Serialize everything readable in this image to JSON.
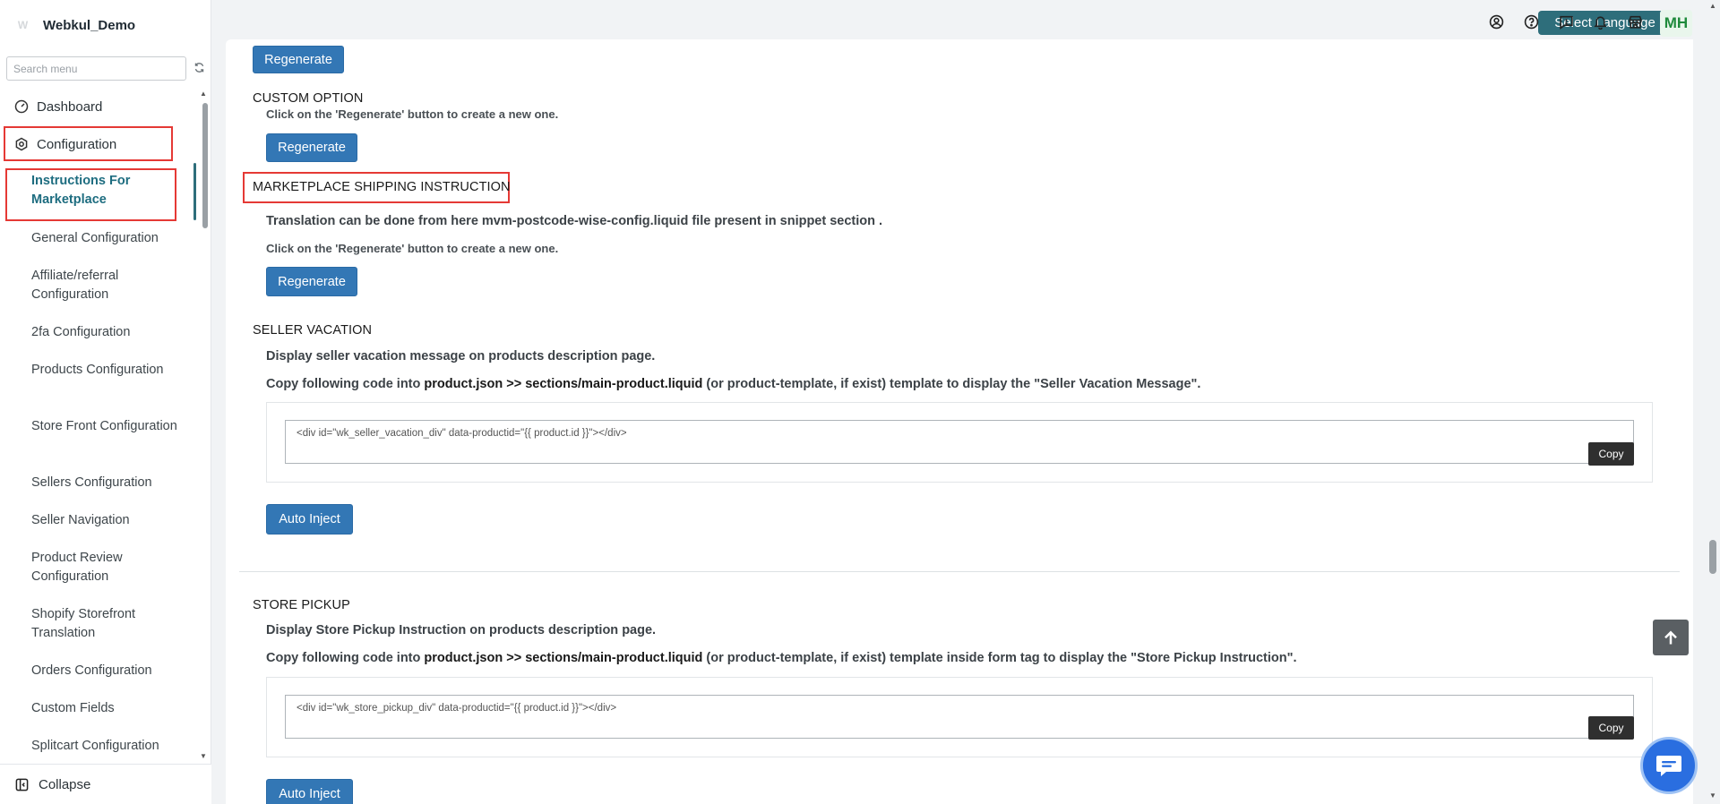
{
  "app": {
    "name": "Webkul_Demo",
    "logo_text": "W"
  },
  "sidebar": {
    "search_placeholder": "Search menu",
    "dashboard": "Dashboard",
    "configuration": "Configuration",
    "items": [
      "Instructions For Marketplace",
      "General Configuration",
      "Affiliate/referral Configuration",
      "2fa Configuration",
      "Products Configuration",
      "Store Front Configuration",
      "Sellers Configuration",
      "Seller Navigation",
      "Product Review Configuration",
      "Shopify Storefront Translation",
      "Orders Configuration",
      "Custom Fields",
      "Splitcart Configuration"
    ],
    "collapse": "Collapse"
  },
  "header": {
    "language_button": "Select Language",
    "avatar_initials": "MH"
  },
  "content": {
    "top_regenerate": "Regenerate",
    "custom_option": {
      "title": "CUSTOM OPTION",
      "note": "Click on the 'Regenerate' button to create a new one.",
      "button": "Regenerate"
    },
    "shipping": {
      "title": "MARKETPLACE SHIPPING INSTRUCTION",
      "text": "Translation can be done from here mvm-postcode-wise-config.liquid file present in snippet section .",
      "note": "Click on the 'Regenerate' button to create a new one.",
      "button": "Regenerate"
    },
    "vacation": {
      "title": "SELLER VACATION",
      "desc": "Display seller vacation message on products description page.",
      "copy_prefix": "Copy following code into ",
      "copy_bold": "product.json >> sections/main-product.liquid",
      "copy_suffix": " (or product-template, if exist) template to display the \"Seller Vacation Message\".",
      "code": "<div id=\"wk_seller_vacation_div\" data-productid=\"{{ product.id }}\"></div>",
      "copy_button": "Copy",
      "inject_button": "Auto Inject"
    },
    "pickup": {
      "title": "STORE PICKUP",
      "desc": "Display Store Pickup Instruction on products description page.",
      "copy_prefix": "Copy following code into ",
      "copy_bold": "product.json >> sections/main-product.liquid",
      "copy_suffix": " (or product-template, if exist) template inside form tag to display the \"Store Pickup Instruction\".",
      "code": "<div id=\"wk_store_pickup_div\" data-productid=\"{{ product.id }}\"></div>",
      "copy_button": "Copy",
      "inject_button": "Auto Inject"
    }
  },
  "colors": {
    "accent": "#2e6e7b",
    "primary_button": "#3377b5",
    "highlight": "#e53935"
  }
}
